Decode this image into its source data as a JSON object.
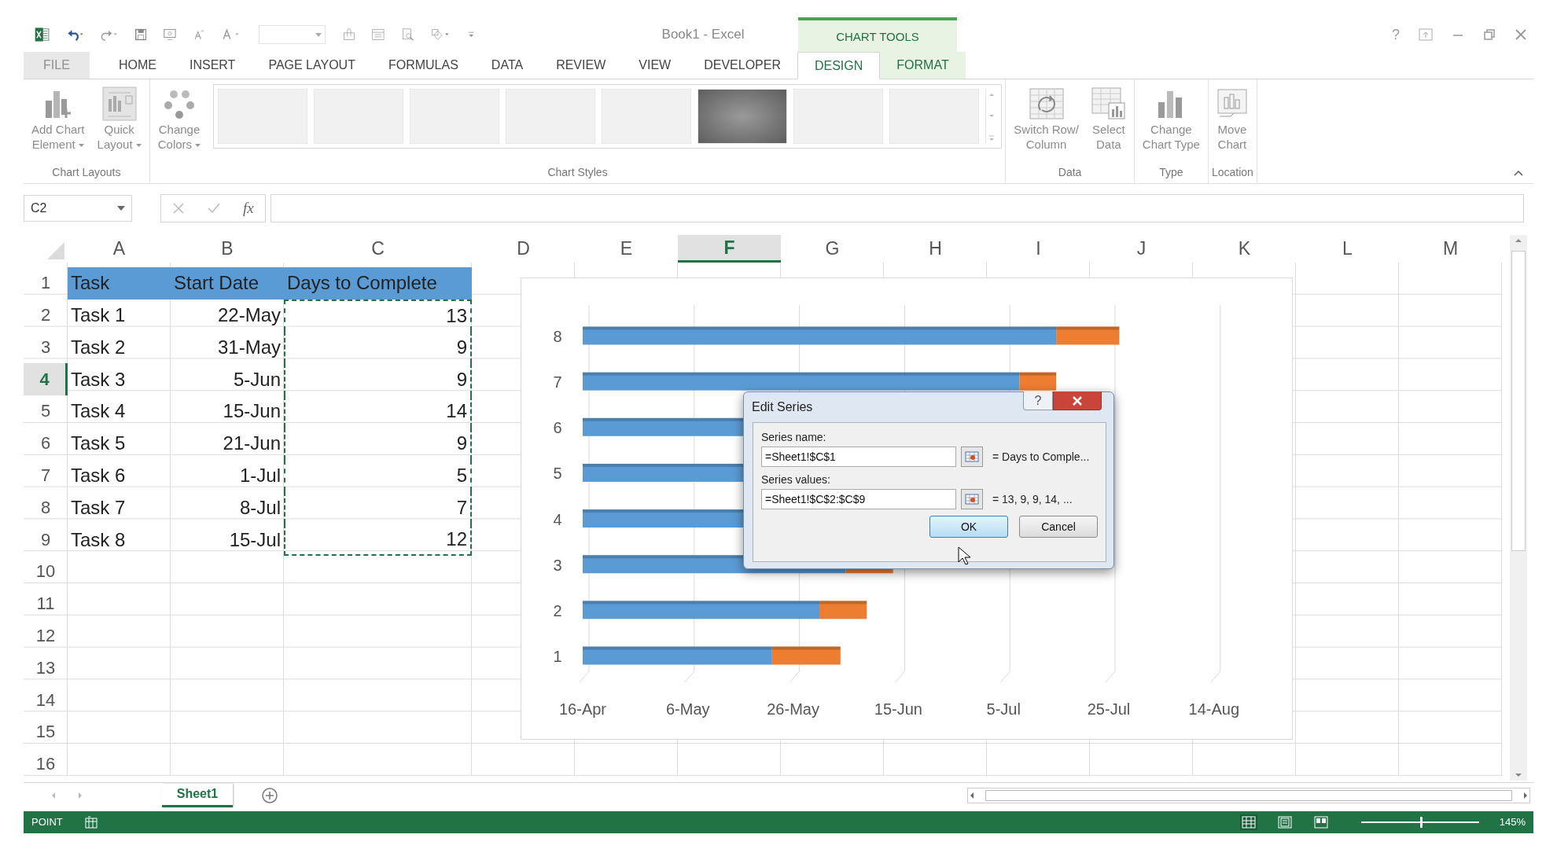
{
  "title_bar": {
    "title": "Book1 - Excel",
    "context_label": "CHART TOOLS",
    "help": "?"
  },
  "tabs": [
    {
      "label": "FILE",
      "kind": "file",
      "selected": false
    },
    {
      "label": "HOME",
      "kind": "normal",
      "selected": false
    },
    {
      "label": "INSERT",
      "kind": "normal",
      "selected": false
    },
    {
      "label": "PAGE LAYOUT",
      "kind": "normal",
      "selected": false
    },
    {
      "label": "FORMULAS",
      "kind": "normal",
      "selected": false
    },
    {
      "label": "DATA",
      "kind": "normal",
      "selected": false
    },
    {
      "label": "REVIEW",
      "kind": "normal",
      "selected": false
    },
    {
      "label": "VIEW",
      "kind": "normal",
      "selected": false
    },
    {
      "label": "DEVELOPER",
      "kind": "normal",
      "selected": false
    },
    {
      "label": "DESIGN",
      "kind": "contextual",
      "selected": true
    },
    {
      "label": "FORMAT",
      "kind": "contextual",
      "selected": false
    }
  ],
  "ribbon": {
    "groups": [
      {
        "label": "Chart Layouts",
        "buttons": [
          {
            "kind": "add-element",
            "lines": [
              "Add Chart",
              "Element"
            ],
            "dropdown": true
          },
          {
            "kind": "quick-layout",
            "lines": [
              "Quick",
              "Layout"
            ],
            "dropdown": true
          }
        ]
      },
      {
        "label": "Chart Styles",
        "buttons": [
          {
            "kind": "colors",
            "lines": [
              "Change",
              "Colors"
            ],
            "dropdown": true
          }
        ],
        "gallery": [
          {
            "selected": false
          },
          {
            "selected": false
          },
          {
            "selected": false
          },
          {
            "selected": false
          },
          {
            "selected": false
          },
          {
            "selected": true
          },
          {
            "selected": false
          },
          {
            "selected": false
          }
        ]
      },
      {
        "label": "Data",
        "buttons": [
          {
            "kind": "switch",
            "lines": [
              "Switch Row/",
              "Column"
            ],
            "dropdown": false
          },
          {
            "kind": "select-data",
            "lines": [
              "Select",
              "Data"
            ],
            "dropdown": false
          }
        ]
      },
      {
        "label": "Type",
        "buttons": [
          {
            "kind": "chart-type",
            "lines": [
              "Change",
              "Chart Type"
            ],
            "dropdown": false
          }
        ]
      },
      {
        "label": "Location",
        "buttons": [
          {
            "kind": "move",
            "lines": [
              "Move",
              "Chart"
            ],
            "dropdown": false
          }
        ]
      }
    ]
  },
  "formula_bar": {
    "name_box": "C2",
    "function_label": "fx"
  },
  "sheet": {
    "columns": [
      {
        "label": "A",
        "selected": false
      },
      {
        "label": "B",
        "selected": false
      },
      {
        "label": "C",
        "selected": false
      },
      {
        "label": "D",
        "selected": false
      },
      {
        "label": "E",
        "selected": false
      },
      {
        "label": "F",
        "selected": true
      },
      {
        "label": "G",
        "selected": false
      },
      {
        "label": "H",
        "selected": false
      },
      {
        "label": "I",
        "selected": false
      },
      {
        "label": "J",
        "selected": false
      },
      {
        "label": "K",
        "selected": false
      },
      {
        "label": "L",
        "selected": false
      },
      {
        "label": "M",
        "selected": false
      }
    ],
    "rows": [
      {
        "number": "1",
        "selected": false,
        "kind": "header",
        "copy_range": false,
        "cells": [
          "Task",
          "Start Date",
          "Days to Complete"
        ]
      },
      {
        "number": "2",
        "selected": false,
        "kind": "data",
        "copy_range": true,
        "cells": [
          "Task 1",
          "22-May",
          "13"
        ]
      },
      {
        "number": "3",
        "selected": false,
        "kind": "data",
        "copy_range": true,
        "cells": [
          "Task 2",
          "31-May",
          "9"
        ]
      },
      {
        "number": "4",
        "selected": true,
        "kind": "data",
        "copy_range": true,
        "cells": [
          "Task 3",
          "5-Jun",
          "9"
        ]
      },
      {
        "number": "5",
        "selected": false,
        "kind": "data",
        "copy_range": true,
        "cells": [
          "Task 4",
          "15-Jun",
          "14"
        ]
      },
      {
        "number": "6",
        "selected": false,
        "kind": "data",
        "copy_range": true,
        "cells": [
          "Task 5",
          "21-Jun",
          "9"
        ]
      },
      {
        "number": "7",
        "selected": false,
        "kind": "data",
        "copy_range": true,
        "cells": [
          "Task 6",
          "1-Jul",
          "5"
        ]
      },
      {
        "number": "8",
        "selected": false,
        "kind": "data",
        "copy_range": true,
        "cells": [
          "Task 7",
          "8-Jul",
          "7"
        ]
      },
      {
        "number": "9",
        "selected": false,
        "kind": "data",
        "copy_range": true,
        "cells": [
          "Task 8",
          "15-Jul",
          "12"
        ]
      },
      {
        "number": "10",
        "selected": false,
        "kind": "data",
        "copy_range": false
      },
      {
        "number": "11",
        "selected": false,
        "kind": "data",
        "copy_range": false
      },
      {
        "number": "12",
        "selected": false,
        "kind": "data",
        "copy_range": false
      },
      {
        "number": "13",
        "selected": false,
        "kind": "data",
        "copy_range": false
      },
      {
        "number": "14",
        "selected": false,
        "kind": "data",
        "copy_range": false
      },
      {
        "number": "15",
        "selected": false,
        "kind": "data",
        "copy_range": false
      },
      {
        "number": "16",
        "selected": false,
        "kind": "data",
        "copy_range": false
      }
    ]
  },
  "chart": {
    "category_labels": [
      "8",
      "7",
      "6",
      "5",
      "4",
      "3",
      "2",
      "1"
    ],
    "axis_labels": [
      "16-Apr",
      "6-May",
      "26-May",
      "15-Jun",
      "5-Jul",
      "25-Jul",
      "14-Aug"
    ]
  },
  "dialog": {
    "title": "Edit Series",
    "help": "?",
    "fields": [
      {
        "label": "Series name:",
        "value": "=Sheet1!$C$1",
        "result": "= Days to Comple..."
      },
      {
        "label": "Series values:",
        "value": "=Sheet1!$C$2:$C$9",
        "result": "= 13, 9, 9, 14, ..."
      }
    ],
    "buttons": [
      {
        "label": "OK",
        "default": true
      },
      {
        "label": "Cancel",
        "default": false
      }
    ]
  },
  "sheet_tabs": [
    {
      "label": "Sheet1",
      "selected": true
    }
  ],
  "status_bar": {
    "mode": "POINT",
    "zoom": "145%",
    "zoom_slider": {
      "level": 0.5
    },
    "views": [
      {
        "kind": "normal",
        "selected": true
      },
      {
        "kind": "page-layout",
        "selected": false
      },
      {
        "kind": "page-break",
        "selected": false
      }
    ]
  }
}
